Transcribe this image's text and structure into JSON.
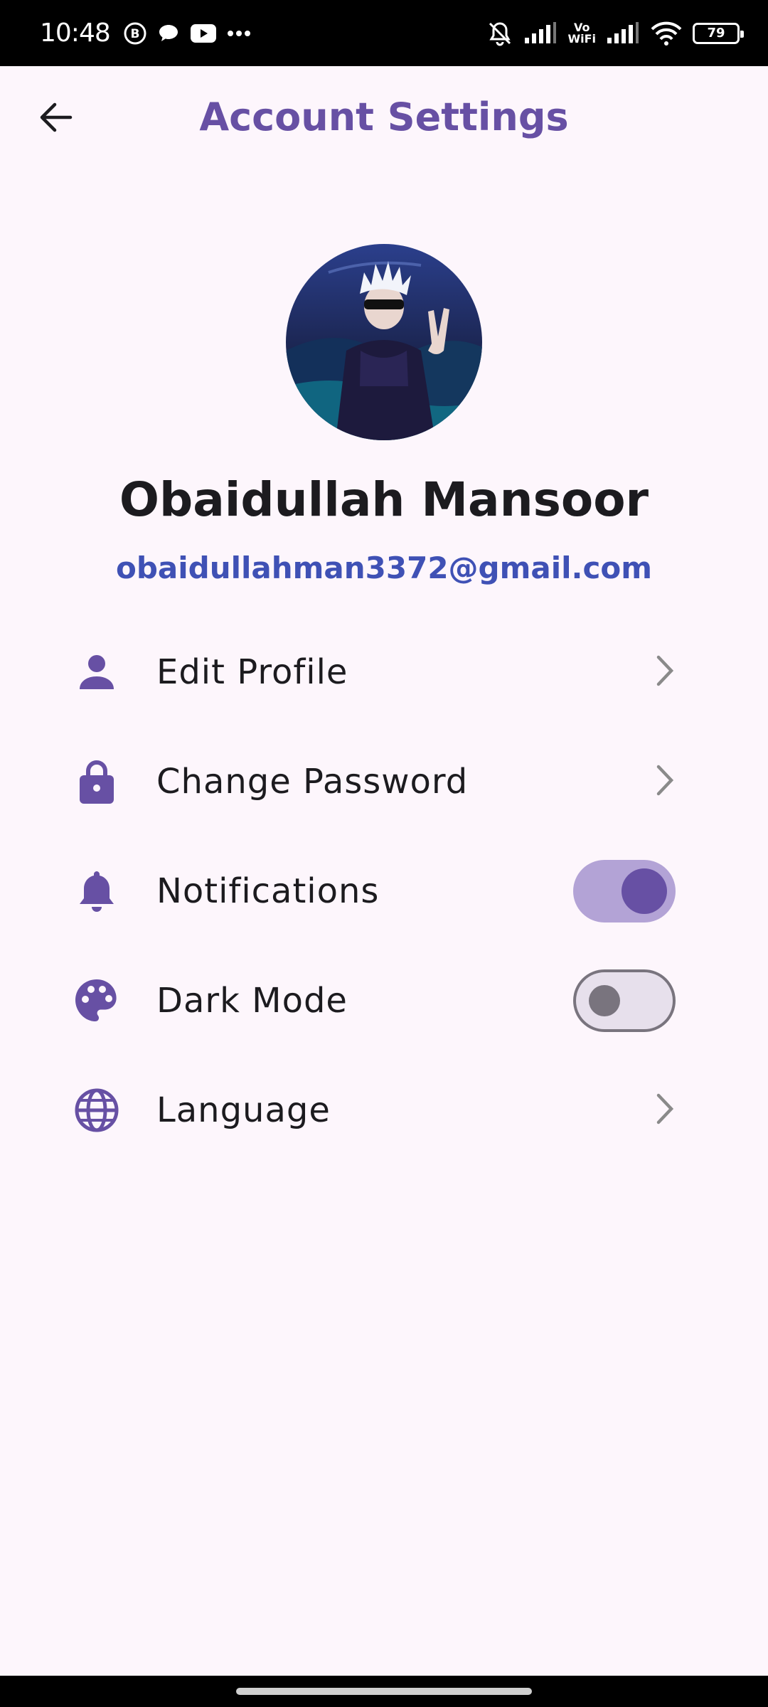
{
  "status_bar": {
    "time": "10:48",
    "left_icons": [
      "b-circle-icon",
      "chat-bubble-icon",
      "youtube-icon",
      "more-dots-icon"
    ],
    "right_icons": [
      "bell-off-icon",
      "signal-icon",
      "vowifi-icon",
      "signal-icon",
      "wifi-icon",
      "battery-icon"
    ],
    "vowifi_label": "Vo\nWiFi",
    "battery_level": "79"
  },
  "app_bar": {
    "back_icon": "arrow-left-icon",
    "title": "Account Settings"
  },
  "profile": {
    "name": "Obaidullah Mansoor",
    "email": "obaidullahman3372@gmail.com"
  },
  "menu": {
    "items": [
      {
        "label": "Edit Profile",
        "icon": "person-icon",
        "trailing": "chevron"
      },
      {
        "label": "Change Password",
        "icon": "lock-icon",
        "trailing": "chevron"
      },
      {
        "label": "Notifications",
        "icon": "bell-icon",
        "trailing": "switch",
        "value": true
      },
      {
        "label": "Dark Mode",
        "icon": "palette-icon",
        "trailing": "switch",
        "value": false
      },
      {
        "label": "Language",
        "icon": "globe-icon",
        "trailing": "chevron"
      }
    ]
  },
  "colors": {
    "accent": "#6750a4",
    "email": "#3f51b5",
    "background": "#fdf6fc",
    "switch_track_on": "#b3a3d6",
    "switch_off": "#79747e"
  }
}
